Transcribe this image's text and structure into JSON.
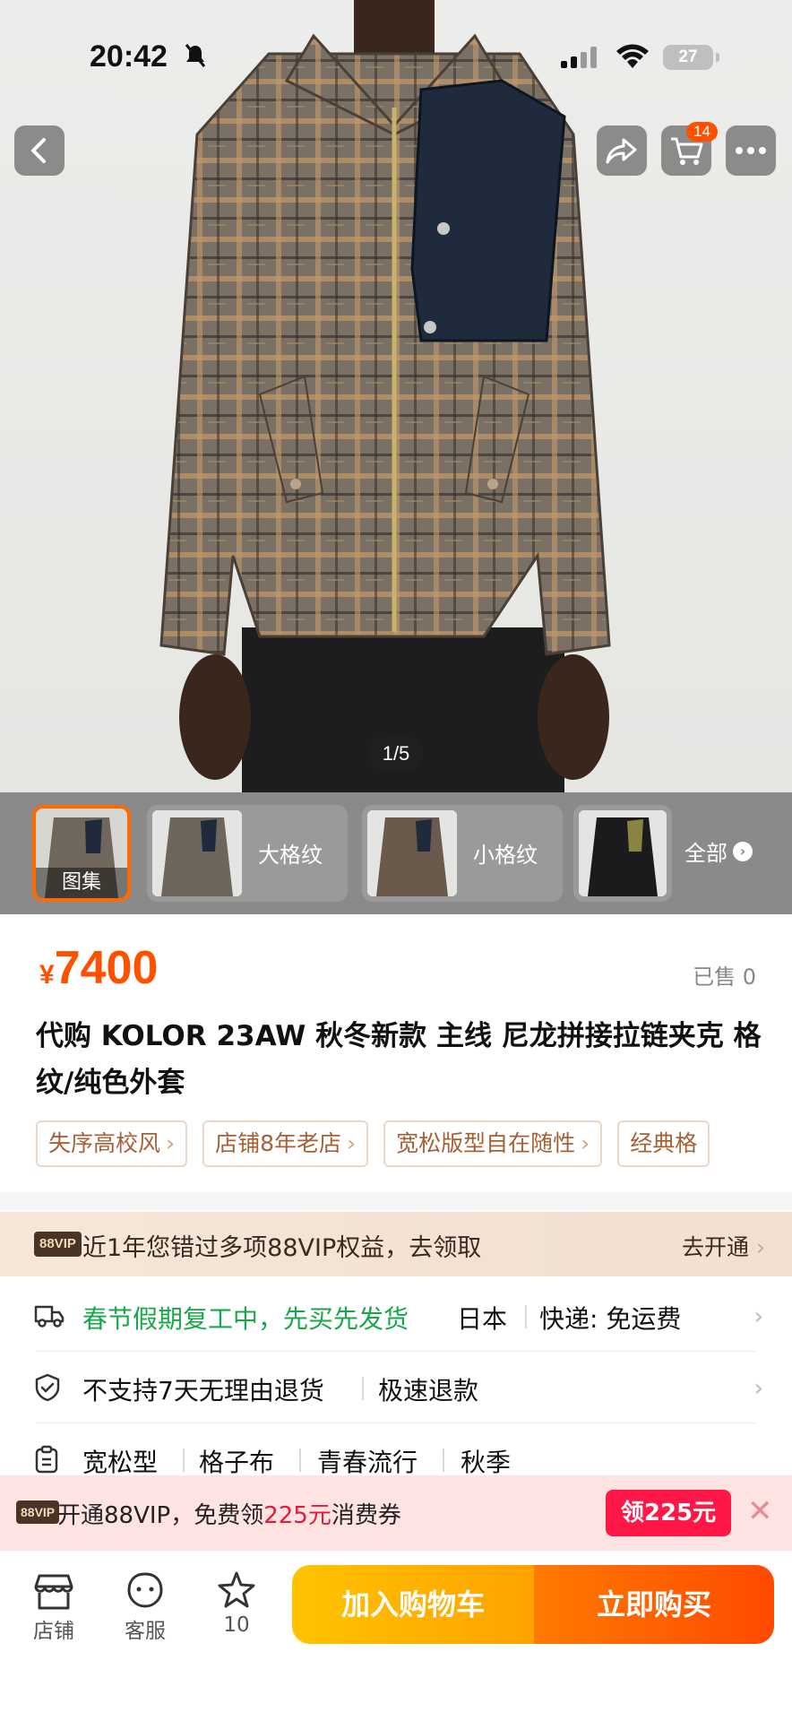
{
  "status_bar": {
    "time": "20:42",
    "battery": "27"
  },
  "nav": {
    "cart_count": "14"
  },
  "gallery": {
    "counter": "1/5"
  },
  "thumbnails": {
    "main_caption": "图集",
    "variants": [
      {
        "label": "大格纹"
      },
      {
        "label": "小格纹"
      }
    ],
    "all_label": "全部"
  },
  "product": {
    "currency": "¥",
    "price": "7400",
    "sold": "已售 0",
    "title": "代购 KOLOR 23AW 秋冬新款 主线 尼龙拼接拉链夹克 格纹/纯色外套",
    "tags": [
      "失序高校风",
      "店铺8年老店",
      "宽松版型自在随性",
      "经典格"
    ]
  },
  "vip_band": {
    "badge": "88VIP",
    "text": "近1年您错过多项88VIP权益，去领取",
    "cta": "去开通"
  },
  "shipping": {
    "notice": "春节假期复工中，先买先发货",
    "origin": "日本",
    "delivery": "快递: 免运费"
  },
  "returns": {
    "policy": "不支持7天无理由退货",
    "refund": "极速退款"
  },
  "attributes": [
    "宽松型",
    "格子布",
    "青春流行",
    "秋季"
  ],
  "promo": {
    "badge": "88VIP",
    "text_before": "开通88VIP，免费领",
    "amount": "225元",
    "text_after": "消费券",
    "button": "领225元"
  },
  "bottom_bar": {
    "shop_label": "店铺",
    "service_label": "客服",
    "fav_count": "10",
    "add_cart": "加入购物车",
    "buy_now": "立即购买"
  },
  "colors": {
    "accent": "#ff5000",
    "green": "#18a84a",
    "promo_red": "#ff1747"
  }
}
